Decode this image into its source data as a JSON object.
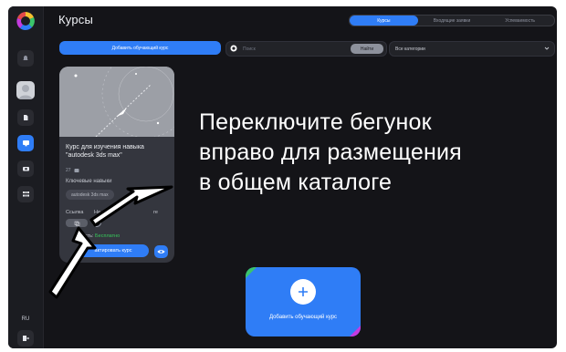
{
  "header": {
    "title": "Курсы",
    "tabs": [
      {
        "label": "Курсы",
        "active": true
      },
      {
        "label": "Входящие заявки",
        "active": false
      },
      {
        "label": "Успеваемость",
        "active": false
      }
    ]
  },
  "sidebar": {
    "language": "RU",
    "icons": [
      "logo-icon",
      "bell-icon",
      "avatar",
      "document-icon",
      "courses-icon",
      "video-icon",
      "apps-icon",
      "logout-icon"
    ]
  },
  "toolbar": {
    "add_course_label": "Добавить обучающий курс",
    "search_placeholder": "Поиск",
    "search_button": "Найти",
    "category_value": "Все категории"
  },
  "course_card": {
    "name_line1": "Курс для изучения навыка",
    "name_line2": "\"autodesk 3ds max\"",
    "lessons": "27",
    "skills_label": "Ключевые навыки",
    "skill": "autodesk 3ds max",
    "link_label": "Ссылка",
    "not_label": "Не о",
    "catalog_label": "ге",
    "price_label": "мость:",
    "price_value": "Бесплатно",
    "edit_button": "актировать курс"
  },
  "add_card": {
    "label": "Добавить обучающий курс"
  },
  "overlay": {
    "line1": "Переключите бегунок",
    "line2": "вправо для размещения",
    "line3": "в общем каталоге"
  },
  "colors": {
    "accent": "#2f7df6",
    "background": "#141418",
    "free": "#37c95b"
  }
}
